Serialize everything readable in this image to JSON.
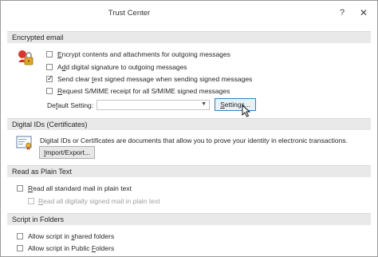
{
  "dialog": {
    "title": "Trust Center",
    "help_label": "?",
    "close_label": "✕"
  },
  "encrypted_email": {
    "header": "Encrypted email",
    "options": [
      {
        "label_pre": "",
        "label_u": "E",
        "label_post": "ncrypt contents and attachments for outgoing messages",
        "checked": false
      },
      {
        "label_pre": "A",
        "label_u": "d",
        "label_post": "d digital signature to outgoing messages",
        "checked": false
      },
      {
        "label_pre": "Send clear ",
        "label_u": "t",
        "label_post": "ext signed message when sending signed messages",
        "checked": true
      },
      {
        "label_pre": "",
        "label_u": "R",
        "label_post": "equest S/MIME receipt for all S/MIME signed messages",
        "checked": false
      }
    ],
    "default_setting_label_pre": "De",
    "default_setting_label_u": "f",
    "default_setting_label_post": "ault Setting:",
    "default_setting_value": "",
    "settings_button_pre": "",
    "settings_button_u": "S",
    "settings_button_post": "ettings..."
  },
  "digital_ids": {
    "header": "Digital IDs (Certificates)",
    "description": "Digital IDs or Certificates are documents that allow you to prove your identity in electronic transactions.",
    "import_export_pre": "",
    "import_export_u": "I",
    "import_export_post": "mport/Export..."
  },
  "plain_text": {
    "header": "Read as Plain Text",
    "options": [
      {
        "label_pre": "",
        "label_u": "R",
        "label_post": "ead all standard mail in plain text",
        "checked": false,
        "disabled": false
      },
      {
        "label_pre": "",
        "label_u": "R",
        "label_post": "ead all digitally signed mail in plain text",
        "checked": false,
        "disabled": true
      }
    ]
  },
  "script_folders": {
    "header": "Script in Folders",
    "options": [
      {
        "label_pre": "Allow script in ",
        "label_u": "s",
        "label_post": "hared folders",
        "checked": false
      },
      {
        "label_pre": "Allow script in Public ",
        "label_u": "F",
        "label_post": "olders",
        "checked": false
      }
    ]
  }
}
